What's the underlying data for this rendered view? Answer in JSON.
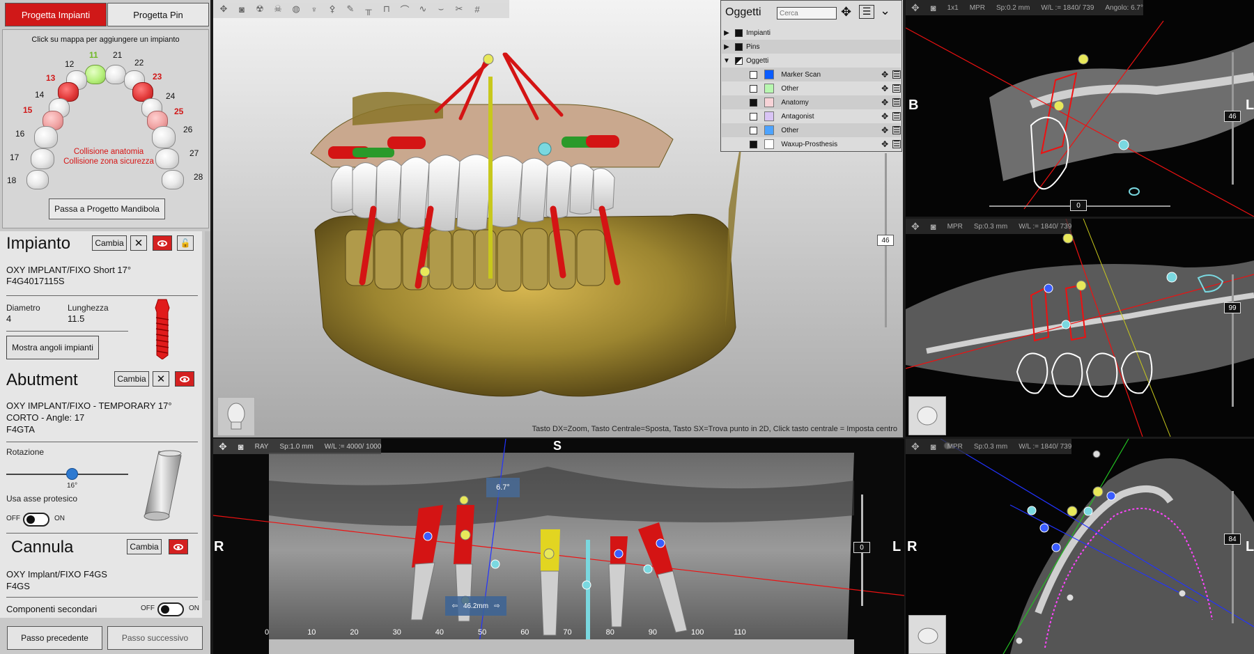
{
  "left_panel": {
    "tabs": {
      "impianti": "Progetta Impianti",
      "pin": "Progetta Pin"
    },
    "arch_hint": "Click su mappa per aggiungere un impianto",
    "teeth": [
      {
        "num": "11",
        "state": "green"
      },
      {
        "num": "21",
        "state": "normal"
      },
      {
        "num": "12",
        "state": "normal"
      },
      {
        "num": "22",
        "state": "normal"
      },
      {
        "num": "13",
        "state": "red"
      },
      {
        "num": "23",
        "state": "red"
      },
      {
        "num": "14",
        "state": "normal"
      },
      {
        "num": "24",
        "state": "normal"
      },
      {
        "num": "15",
        "state": "pink"
      },
      {
        "num": "25",
        "state": "pink"
      },
      {
        "num": "16",
        "state": "normal"
      },
      {
        "num": "26",
        "state": "normal"
      },
      {
        "num": "17",
        "state": "normal"
      },
      {
        "num": "27",
        "state": "normal"
      },
      {
        "num": "18",
        "state": "normal"
      },
      {
        "num": "28",
        "state": "normal"
      }
    ],
    "collision_1": "Collisione anatomia",
    "collision_2": "Collisione zona sicurezza",
    "btn_mandibola": "Passa a Progetto Mandibola",
    "impianto": {
      "title": "Impianto",
      "cambia": "Cambia",
      "name": "OXY IMPLANT/FIXO Short 17°",
      "code": "F4G4017115S",
      "diametro_label": "Diametro",
      "diametro": "4",
      "lunghezza_label": "Lunghezza",
      "lunghezza": "11.5",
      "btn_angoli": "Mostra angoli impianti"
    },
    "abutment": {
      "title": "Abutment",
      "cambia": "Cambia",
      "name": "OXY IMPLANT/FIXO - TEMPORARY 17°",
      "line2": "CORTO - Angle: 17",
      "code": "F4GTA",
      "rotazione_label": "Rotazione",
      "rotazione_value": "16°",
      "usa_asse": "Usa asse protesico",
      "off": "OFF",
      "on": "ON"
    },
    "cannula": {
      "title": "Cannula",
      "cambia": "Cambia",
      "name": "OXY Implant/FIXO F4GS",
      "code": "F4GS"
    },
    "componenti": {
      "label": "Componenti secondari",
      "off": "OFF",
      "on": "ON"
    },
    "btn_prev": "Passo precedente",
    "btn_next": "Passo successivo"
  },
  "view3d": {
    "hint": "Tasto DX=Zoom, Tasto Centrale=Sposta, Tasto SX=Trova punto in 2D, Click tasto centrale = Imposta centro",
    "slider_value": "46"
  },
  "oggetti": {
    "title": "Oggetti",
    "search_placeholder": "Cerca",
    "groups": [
      {
        "label": "Impianti",
        "expanded": false
      },
      {
        "label": "Pins",
        "expanded": false
      },
      {
        "label": "Oggetti",
        "expanded": true
      }
    ],
    "items": [
      {
        "label": "Marker Scan",
        "checked": false,
        "color": "#0a5cff"
      },
      {
        "label": "Other",
        "checked": false,
        "color": "#b8f7b0"
      },
      {
        "label": "Anatomy",
        "checked": true,
        "color": "#f7d3d7"
      },
      {
        "label": "Antagonist",
        "checked": false,
        "color": "#d9c4f5"
      },
      {
        "label": "Other",
        "checked": false,
        "color": "#4da3ff"
      },
      {
        "label": "Waxup-Prosthesis",
        "checked": true,
        "color": "#ffffff"
      }
    ]
  },
  "pano": {
    "mode": "RAY",
    "sp": "Sp:1.0 mm",
    "wl": "W/L := 4000/ 1000",
    "label_s": "S",
    "label_r": "R",
    "label_l": "L",
    "angle": "6.7°",
    "measure": "46.2mm",
    "slider_value": "0",
    "ruler": [
      "0",
      "10",
      "20",
      "30",
      "40",
      "50",
      "60",
      "70",
      "80",
      "90",
      "100",
      "110"
    ]
  },
  "vp_top": {
    "zoom": "1x1",
    "mode": "MPR",
    "sp": "Sp:0.2 mm",
    "wl": "W/L := 1840/ 739",
    "angolo": "Angolo: 6.7°",
    "label_b": "B",
    "label_l": "L",
    "slider_value": "46",
    "bottom_value": "0"
  },
  "vp_mid": {
    "mode": "MPR",
    "sp": "Sp:0.3 mm",
    "wl": "W/L := 1840/ 739",
    "slider_value": "99"
  },
  "vp_bot": {
    "mode": "MPR",
    "sp": "Sp:0.3 mm",
    "wl": "W/L := 1840/ 739",
    "label_r": "R",
    "label_l": "L",
    "slider_value": "84"
  }
}
